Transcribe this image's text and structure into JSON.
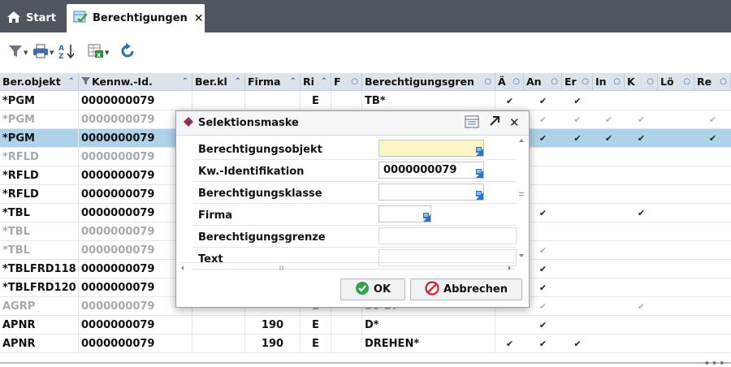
{
  "tabs": [
    {
      "label": "Start",
      "icon": "home-icon"
    },
    {
      "label": "Berechtigungen",
      "icon": "permissions-icon",
      "active": true
    }
  ],
  "toolbar": {
    "icons": [
      "filter-icon",
      "print-icon",
      "sort-az-icon",
      "excel-export-icon",
      "refresh-icon"
    ]
  },
  "colors": {
    "header_bg": "#dde3ea",
    "selected_row": "#aed2ea",
    "tabbar": "#4f565d",
    "accent": "#2a73c4"
  },
  "table": {
    "columns": [
      "Ber.objekt",
      "Kennw.-Id.",
      "Ber.kl",
      "Firma",
      "Ri",
      "F",
      "Berechtigungsgren",
      "Ä",
      "An",
      "Er",
      "In",
      "K",
      "Lö",
      "Re"
    ],
    "rows": [
      {
        "obj": "*PGM",
        "kid": "0000000079",
        "berkl": "",
        "firma": "",
        "ri": "E",
        "f": "",
        "grenze": "TB*",
        "c": [
          1,
          1,
          1,
          0,
          0,
          0,
          0
        ],
        "dim": false,
        "selected": false
      },
      {
        "obj": "*PGM",
        "kid": "0000000079",
        "berkl": "",
        "firma": "",
        "ri": "",
        "f": "",
        "grenze": "",
        "c": [
          1,
          1,
          1,
          1,
          1,
          0,
          1
        ],
        "dim": true,
        "selected": false
      },
      {
        "obj": "*PGM",
        "kid": "0000000079",
        "berkl": "",
        "firma": "",
        "ri": "",
        "f": "",
        "grenze": "",
        "c": [
          1,
          1,
          1,
          1,
          1,
          0,
          1
        ],
        "dim": false,
        "selected": true
      },
      {
        "obj": "*RFLD",
        "kid": "0000000079",
        "berkl": "",
        "firma": "",
        "ri": "",
        "f": "",
        "grenze": "",
        "c": [
          0,
          0,
          0,
          0,
          0,
          0,
          0
        ],
        "dim": true,
        "selected": false
      },
      {
        "obj": "*RFLD",
        "kid": "0000000079",
        "berkl": "",
        "firma": "",
        "ri": "",
        "f": "",
        "grenze": "",
        "c": [
          0,
          0,
          0,
          0,
          0,
          0,
          0
        ],
        "dim": false,
        "selected": false
      },
      {
        "obj": "*RFLD",
        "kid": "0000000079",
        "berkl": "",
        "firma": "",
        "ri": "",
        "f": "",
        "grenze": "",
        "c": [
          0,
          0,
          0,
          0,
          0,
          0,
          0
        ],
        "dim": false,
        "selected": false
      },
      {
        "obj": "*TBL",
        "kid": "0000000079",
        "berkl": "",
        "firma": "",
        "ri": "",
        "f": "",
        "grenze": "",
        "c": [
          0,
          1,
          0,
          0,
          1,
          0,
          0
        ],
        "dim": false,
        "selected": false
      },
      {
        "obj": "*TBL",
        "kid": "0000000079",
        "berkl": "",
        "firma": "",
        "ri": "",
        "f": "",
        "grenze": "",
        "c": [
          0,
          0,
          0,
          0,
          0,
          0,
          0
        ],
        "dim": true,
        "selected": false
      },
      {
        "obj": "*TBL",
        "kid": "0000000079",
        "berkl": "",
        "firma": "",
        "ri": "",
        "f": "",
        "grenze": "",
        "c": [
          0,
          1,
          0,
          0,
          0,
          0,
          0
        ],
        "dim": true,
        "selected": false
      },
      {
        "obj": "*TBLFRD118",
        "kid": "0000000079",
        "berkl": "",
        "firma": "",
        "ri": "",
        "f": "",
        "grenze": "",
        "c": [
          0,
          1,
          0,
          0,
          0,
          0,
          0
        ],
        "dim": false,
        "selected": false
      },
      {
        "obj": "*TBLFRD120",
        "kid": "0000000079",
        "berkl": "",
        "firma": "",
        "ri": "",
        "f": "",
        "grenze": "",
        "c": [
          0,
          1,
          0,
          0,
          0,
          0,
          0
        ],
        "dim": false,
        "selected": false
      },
      {
        "obj": "AGRP",
        "kid": "0000000079",
        "berkl": "",
        "firma": "",
        "ri": "E",
        "f": "",
        "grenze": "S0-S7",
        "c": [
          0,
          1,
          0,
          0,
          1,
          0,
          0
        ],
        "dim": true,
        "selected": false
      },
      {
        "obj": "APNR",
        "kid": "0000000079",
        "berkl": "",
        "firma": "190",
        "ri": "E",
        "f": "",
        "grenze": "D*",
        "c": [
          0,
          1,
          0,
          0,
          0,
          0,
          0
        ],
        "dim": false,
        "selected": false
      },
      {
        "obj": "APNR",
        "kid": "0000000079",
        "berkl": "",
        "firma": "190",
        "ri": "E",
        "f": "",
        "grenze": "DREHEN*",
        "c": [
          1,
          1,
          1,
          0,
          0,
          0,
          0
        ],
        "dim": false,
        "selected": false
      }
    ]
  },
  "dialog": {
    "title": "Selektionsmaske",
    "fields": [
      {
        "label": "Berechtigungsobjekt",
        "value": ""
      },
      {
        "label": "Kw.-Identifikation",
        "value": "0000000079"
      },
      {
        "label": "Berechtigungsklasse",
        "value": ""
      },
      {
        "label": "Firma",
        "value": ""
      },
      {
        "label": "Berechtigungsgrenze",
        "value": ""
      },
      {
        "label": "Text",
        "value": ""
      }
    ],
    "ok_label": "OK",
    "cancel_label": "Abbrechen"
  }
}
